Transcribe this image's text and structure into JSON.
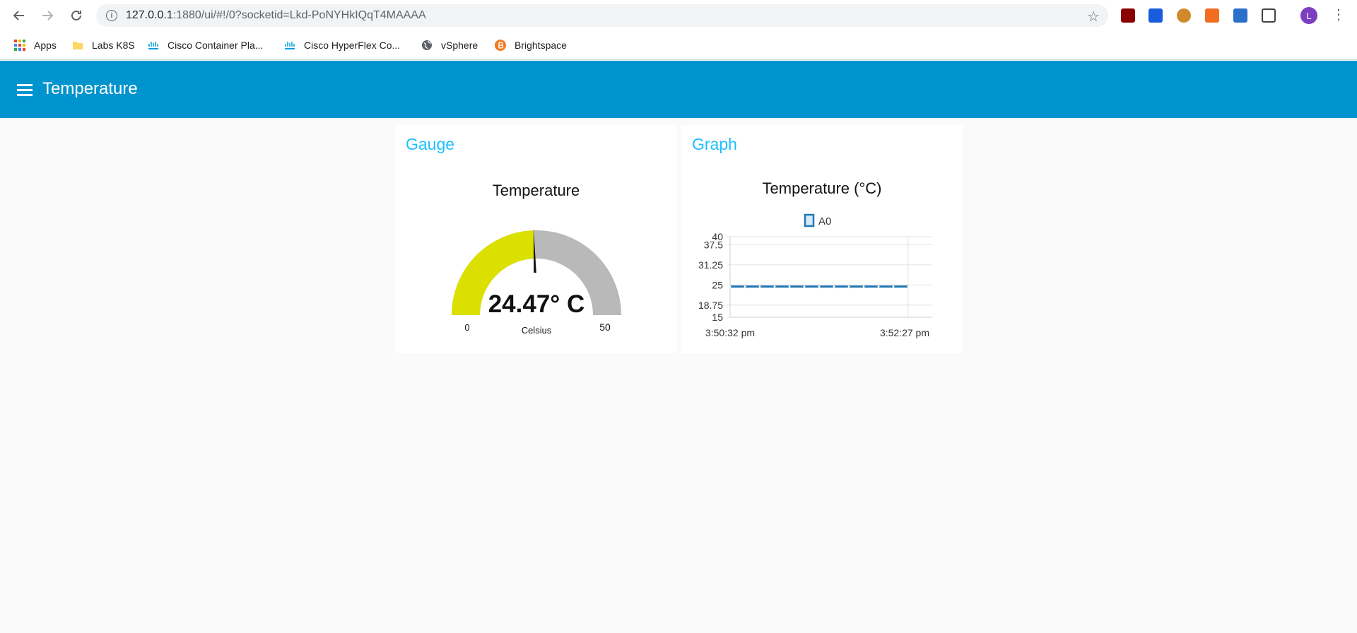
{
  "browser": {
    "url_host": "127.0.0.1",
    "url_rest": ":1880/ui/#!/0?socketid=Lkd-PoNYHkIQqT4MAAAA",
    "info_glyph": "i",
    "back_icon": "arrow-left-icon",
    "forward_icon": "arrow-right-icon",
    "reload_icon": "reload-icon",
    "star_icon": "star-icon",
    "profile_initial": "L",
    "profile_color": "#7b3fbf"
  },
  "bookmarks": [
    {
      "label": "Apps",
      "icon": "apps-grid-icon"
    },
    {
      "label": "Labs K8S",
      "icon": "folder-icon"
    },
    {
      "label": "Cisco Container Pla...",
      "icon": "cisco-icon"
    },
    {
      "label": "Cisco HyperFlex Co...",
      "icon": "cisco-icon"
    },
    {
      "label": "vSphere",
      "icon": "globe-icon"
    },
    {
      "label": "Brightspace",
      "icon": "brightspace-icon"
    }
  ],
  "app": {
    "title": "Temperature",
    "header_color": "#0094ce",
    "accent": "#1bbfff"
  },
  "gauge_card": {
    "group_title": "Gauge",
    "widget_title": "Temperature",
    "value_text": "24.47° C",
    "units": "Celsius",
    "min_label": "0",
    "max_label": "50",
    "value": 24.47,
    "min": 0,
    "max": 50,
    "fill_color": "#dce000",
    "track_color": "#b9b9b9"
  },
  "graph_card": {
    "group_title": "Graph",
    "widget_title": "Temperature (°C)"
  },
  "chart_data": {
    "type": "line",
    "title": "Temperature (°C)",
    "legend": [
      "A0"
    ],
    "legend_position": "top",
    "grid": true,
    "ylim": [
      15,
      40
    ],
    "y_ticks": [
      "40",
      "37.5",
      "31.25",
      "25",
      "18.75",
      "15"
    ],
    "x_tick_labels": [
      "3:50:32 pm",
      "3:52:27 pm"
    ],
    "series": [
      {
        "name": "A0",
        "color": "#1f77b4",
        "x": [
          "3:50:32 pm",
          "3:50:42 pm",
          "3:50:52 pm",
          "3:51:02 pm",
          "3:51:12 pm",
          "3:51:22 pm",
          "3:51:32 pm",
          "3:51:42 pm",
          "3:51:52 pm",
          "3:52:02 pm",
          "3:52:12 pm",
          "3:52:22 pm",
          "3:52:27 pm"
        ],
        "values": [
          24.5,
          24.5,
          24.5,
          24.5,
          24.5,
          24.5,
          24.5,
          24.5,
          24.5,
          24.5,
          24.5,
          24.5,
          24.5
        ]
      }
    ]
  }
}
